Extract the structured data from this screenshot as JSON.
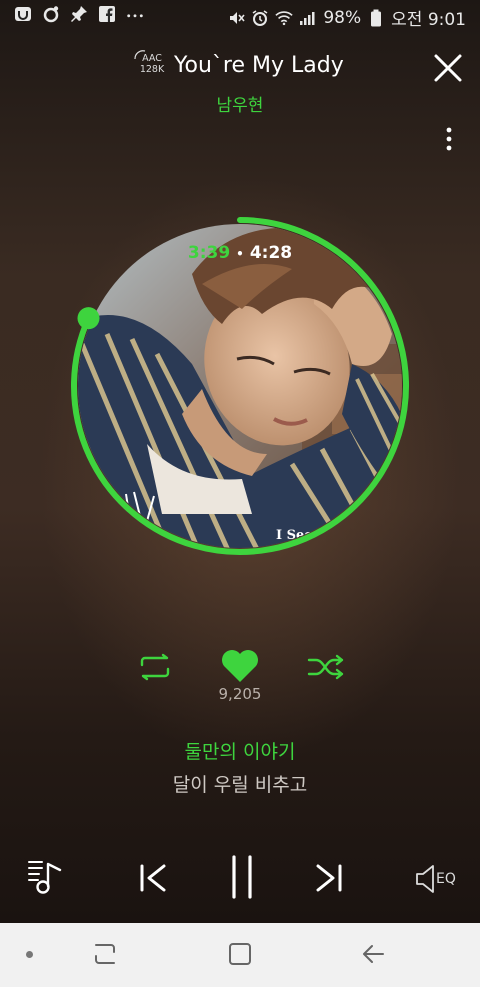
{
  "status_bar": {
    "battery": "98%",
    "time": "오전 9:01",
    "left_icons": [
      "notification-icon",
      "settings-icon",
      "pin-icon",
      "facebook-icon",
      "more-notifications-icon"
    ],
    "right_icons": [
      "mute-icon",
      "alarm-icon",
      "wifi-icon",
      "signal-icon",
      "battery-icon"
    ]
  },
  "header": {
    "quality_line1": "AAC",
    "quality_line2": "128K",
    "title": "You`re My Lady",
    "artist": "남우현"
  },
  "player": {
    "current_time": "3:39",
    "separator": "•",
    "total_time": "4:28",
    "progress_fraction": 0.817,
    "like_count": "9,205",
    "album_caption": "I Second"
  },
  "lyrics": {
    "current": "둘만의 이야기",
    "next": "달이 우릴 비추고"
  },
  "controls": {
    "eq_label": "EQ"
  },
  "colors": {
    "accent": "#3ed43e",
    "text": "#ffffff",
    "muted": "#b9b0aa",
    "navbar": "#f1f1f1"
  }
}
